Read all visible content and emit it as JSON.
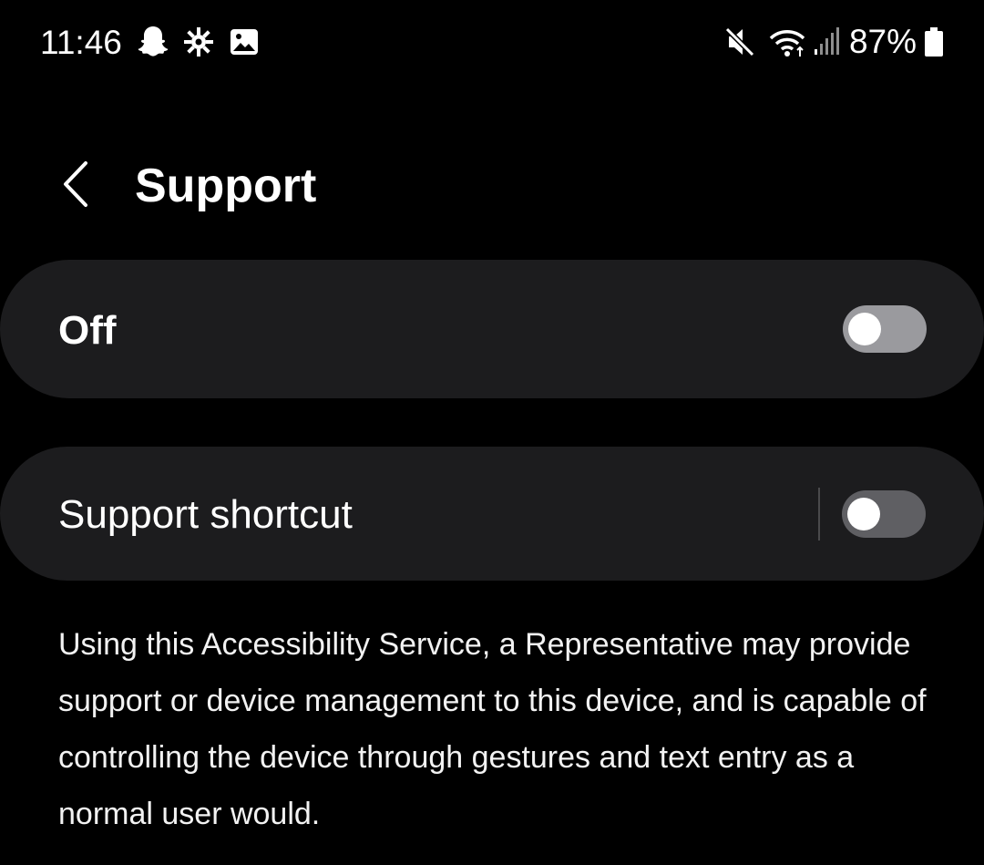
{
  "status_bar": {
    "time": "11:46",
    "battery_percent": "87%",
    "left_icons": [
      "snapchat-icon",
      "settings-burst-icon",
      "gallery-icon"
    ],
    "right_icons": [
      "mute-icon",
      "wifi-icon",
      "signal-icon",
      "battery-icon"
    ]
  },
  "header": {
    "title": "Support",
    "back_icon": "chevron-left-icon"
  },
  "master_switch": {
    "label": "Off",
    "state": "off"
  },
  "shortcut": {
    "label": "Support shortcut",
    "state": "off"
  },
  "description": "Using this Accessibility Service, a Representative may provide support or device management to this device, and is capable of controlling the device through gestures and text entry as a normal user would.",
  "colors": {
    "background": "#000000",
    "card": "#1c1c1e",
    "toggle_master_track": "#9a9a9e",
    "toggle_shortcut_track": "#5f5f63",
    "text": "#ffffff"
  }
}
